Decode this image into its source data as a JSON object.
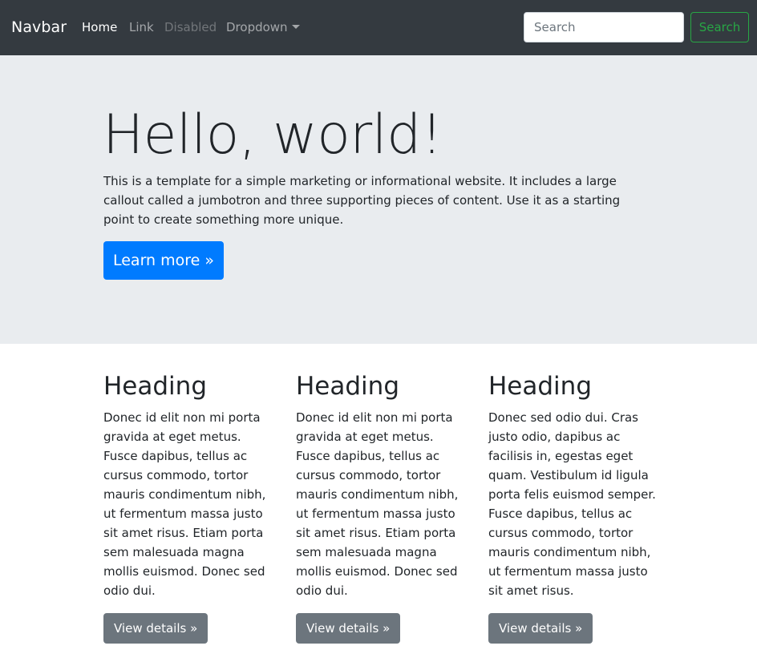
{
  "navbar": {
    "brand": "Navbar",
    "links": [
      {
        "label": "Home",
        "state": "active"
      },
      {
        "label": "Link",
        "state": "normal"
      },
      {
        "label": "Disabled",
        "state": "disabled"
      },
      {
        "label": "Dropdown",
        "state": "normal"
      }
    ],
    "search_placeholder": "Search",
    "search_button": "Search"
  },
  "jumbotron": {
    "title": "Hello, world!",
    "text": "This is a template for a simple marketing or informational website. It includes a large callout called a jumbotron and three supporting pieces of content. Use it as a starting point to create something more unique.",
    "button": "Learn more »"
  },
  "columns": [
    {
      "heading": "Heading",
      "text": "Donec id elit non mi porta gravida at eget metus. Fusce dapibus, tellus ac cursus commodo, tortor mauris condimentum nibh, ut fermentum massa justo sit amet risus. Etiam porta sem malesuada magna mollis euismod. Donec sed odio dui.",
      "button": "View details »"
    },
    {
      "heading": "Heading",
      "text": "Donec id elit non mi porta gravida at eget metus. Fusce dapibus, tellus ac cursus commodo, tortor mauris condimentum nibh, ut fermentum massa justo sit amet risus. Etiam porta sem malesuada magna mollis euismod. Donec sed odio dui.",
      "button": "View details »"
    },
    {
      "heading": "Heading",
      "text": "Donec sed odio dui. Cras justo odio, dapibus ac facilisis in, egestas eget quam. Vestibulum id ligula porta felis euismod semper. Fusce dapibus, tellus ac cursus commodo, tortor mauris condimentum nibh, ut fermentum massa justo sit amet risus.",
      "button": "View details »"
    }
  ],
  "colors": {
    "navbar_bg": "#343a40",
    "jumbotron_bg": "#e9ecef",
    "primary": "#007bff",
    "success": "#28a745",
    "secondary": "#6c757d"
  },
  "icons": {
    "dropdown": "caret-down-icon"
  }
}
